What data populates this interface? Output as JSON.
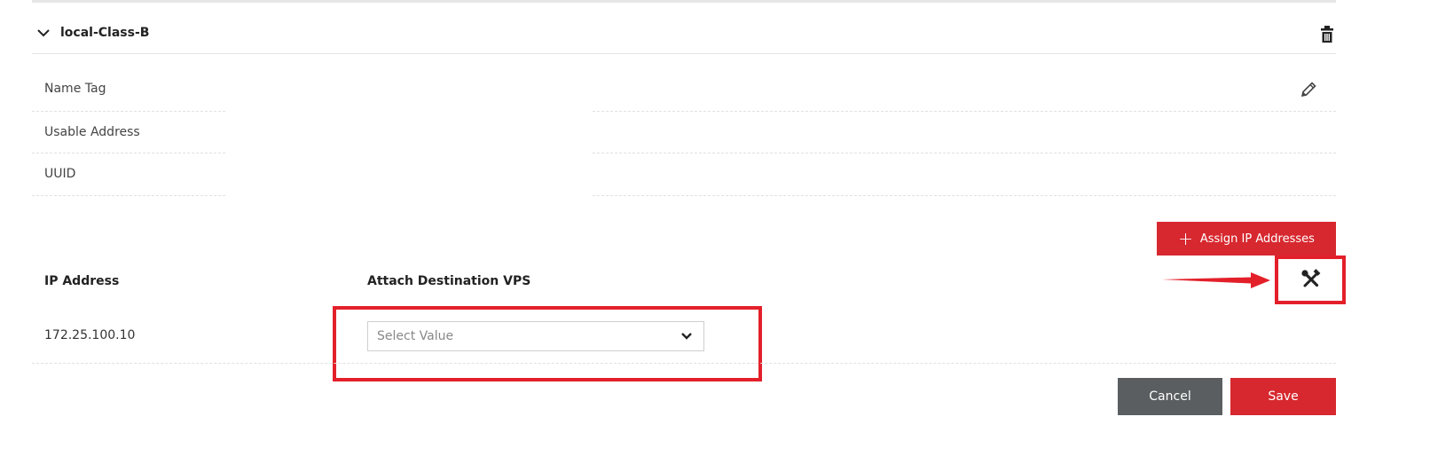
{
  "section": {
    "title": "local-Class-B",
    "toggle_icon": "chevron-down-icon",
    "delete_icon": "trash-icon"
  },
  "details": {
    "edit_icon": "pencil-icon",
    "rows": [
      {
        "label": "Name Tag"
      },
      {
        "label": "Usable Address"
      },
      {
        "label": "UUID"
      }
    ]
  },
  "actions": {
    "assign_label": "Assign IP Addresses",
    "assign_icon": "plus-icon",
    "tools_icon": "wrench-screwdriver-icon"
  },
  "table": {
    "col_ip": "IP Address",
    "col_vps": "Attach Destination VPS",
    "rows": [
      {
        "ip": "172.25.100.10",
        "vps_placeholder": "Select Value"
      }
    ]
  },
  "footer": {
    "cancel_label": "Cancel",
    "save_label": "Save"
  },
  "colors": {
    "accent": "#d7282f",
    "highlight": "#e3202a",
    "cancel": "#5a5e61"
  }
}
